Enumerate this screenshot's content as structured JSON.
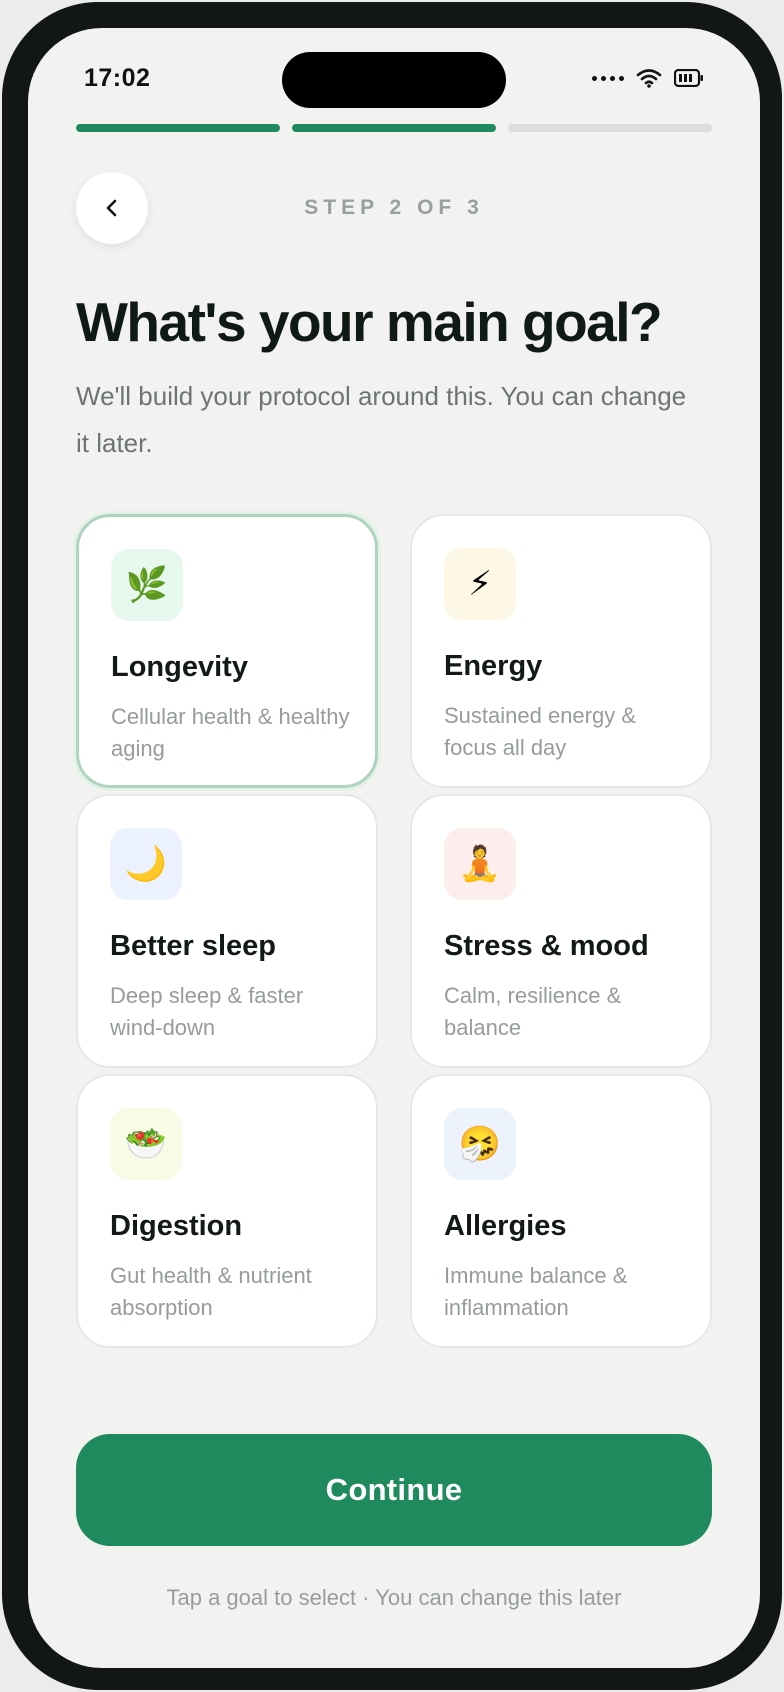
{
  "status_bar": {
    "time": "17:02"
  },
  "progress": {
    "total_steps": 3,
    "current_step": 2
  },
  "header": {
    "step_label": "STEP 2 OF 3"
  },
  "main": {
    "title": "What's your main goal?",
    "subtitle": "We'll build your protocol around this. You can change it later."
  },
  "goals": [
    {
      "name": "Longevity",
      "desc": "Cellular health & healthy aging",
      "icon": "herb-icon",
      "emoji": "🌿",
      "tile_color": "#e7f8ef",
      "selected": true
    },
    {
      "name": "Energy",
      "desc": "Sustained energy & focus all day",
      "icon": "lightning-icon",
      "emoji": "⚡",
      "tile_color": "#fdf8e6",
      "selected": false
    },
    {
      "name": "Better sleep",
      "desc": "Deep sleep & faster wind-down",
      "icon": "crescent-moon-icon",
      "emoji": "🌙",
      "tile_color": "#ecf2fd",
      "selected": false
    },
    {
      "name": "Stress & mood",
      "desc": "Calm, resilience & balance",
      "icon": "meditation-icon",
      "emoji": "🧘",
      "tile_color": "#fdeeed",
      "selected": false
    },
    {
      "name": "Digestion",
      "desc": "Gut health & nutrient absorption",
      "icon": "salad-icon",
      "emoji": "🥗",
      "tile_color": "#f8fbe6",
      "selected": false
    },
    {
      "name": "Allergies",
      "desc": "Immune balance & inflammation",
      "icon": "sneezing-face-icon",
      "emoji": "🤧",
      "tile_color": "#ecf3fd",
      "selected": false
    }
  ],
  "actions": {
    "continue_label": "Continue"
  },
  "footer": {
    "hint": "Tap a goal to select · You can change this later"
  },
  "colors": {
    "accent": "#1f8a5e",
    "selected_border": "#aed4c0",
    "background": "#f2f3f1"
  }
}
